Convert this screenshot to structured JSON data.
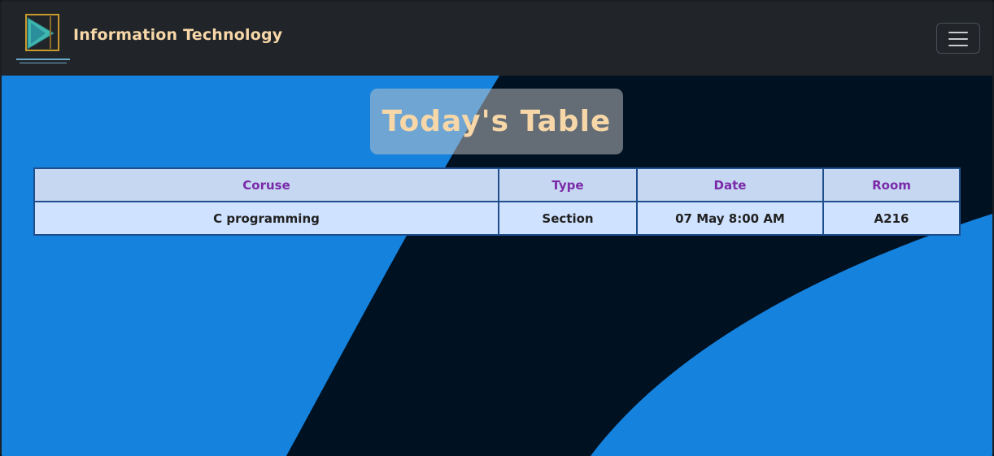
{
  "navbar": {
    "brand": "Information Technology",
    "logo_icon": "play-logo-icon",
    "menu_icon": "hamburger-menu-icon"
  },
  "hero": {
    "title": "Today's Table"
  },
  "table": {
    "headers": [
      "Coruse",
      "Type",
      "Date",
      "Room"
    ],
    "rows": [
      [
        "C programming",
        "Section",
        "07 May 8:00 AM",
        "A216"
      ]
    ]
  },
  "colors": {
    "navbar_bg": "#212529",
    "brand_text": "#f7d7a8",
    "hero_blue": "#1583de",
    "hero_dark": "#001122",
    "header_text": "#7a2aa8",
    "header_bg": "#c6d7f2",
    "row_bg": "#cfe2ff",
    "table_border": "#1f4e8c"
  }
}
